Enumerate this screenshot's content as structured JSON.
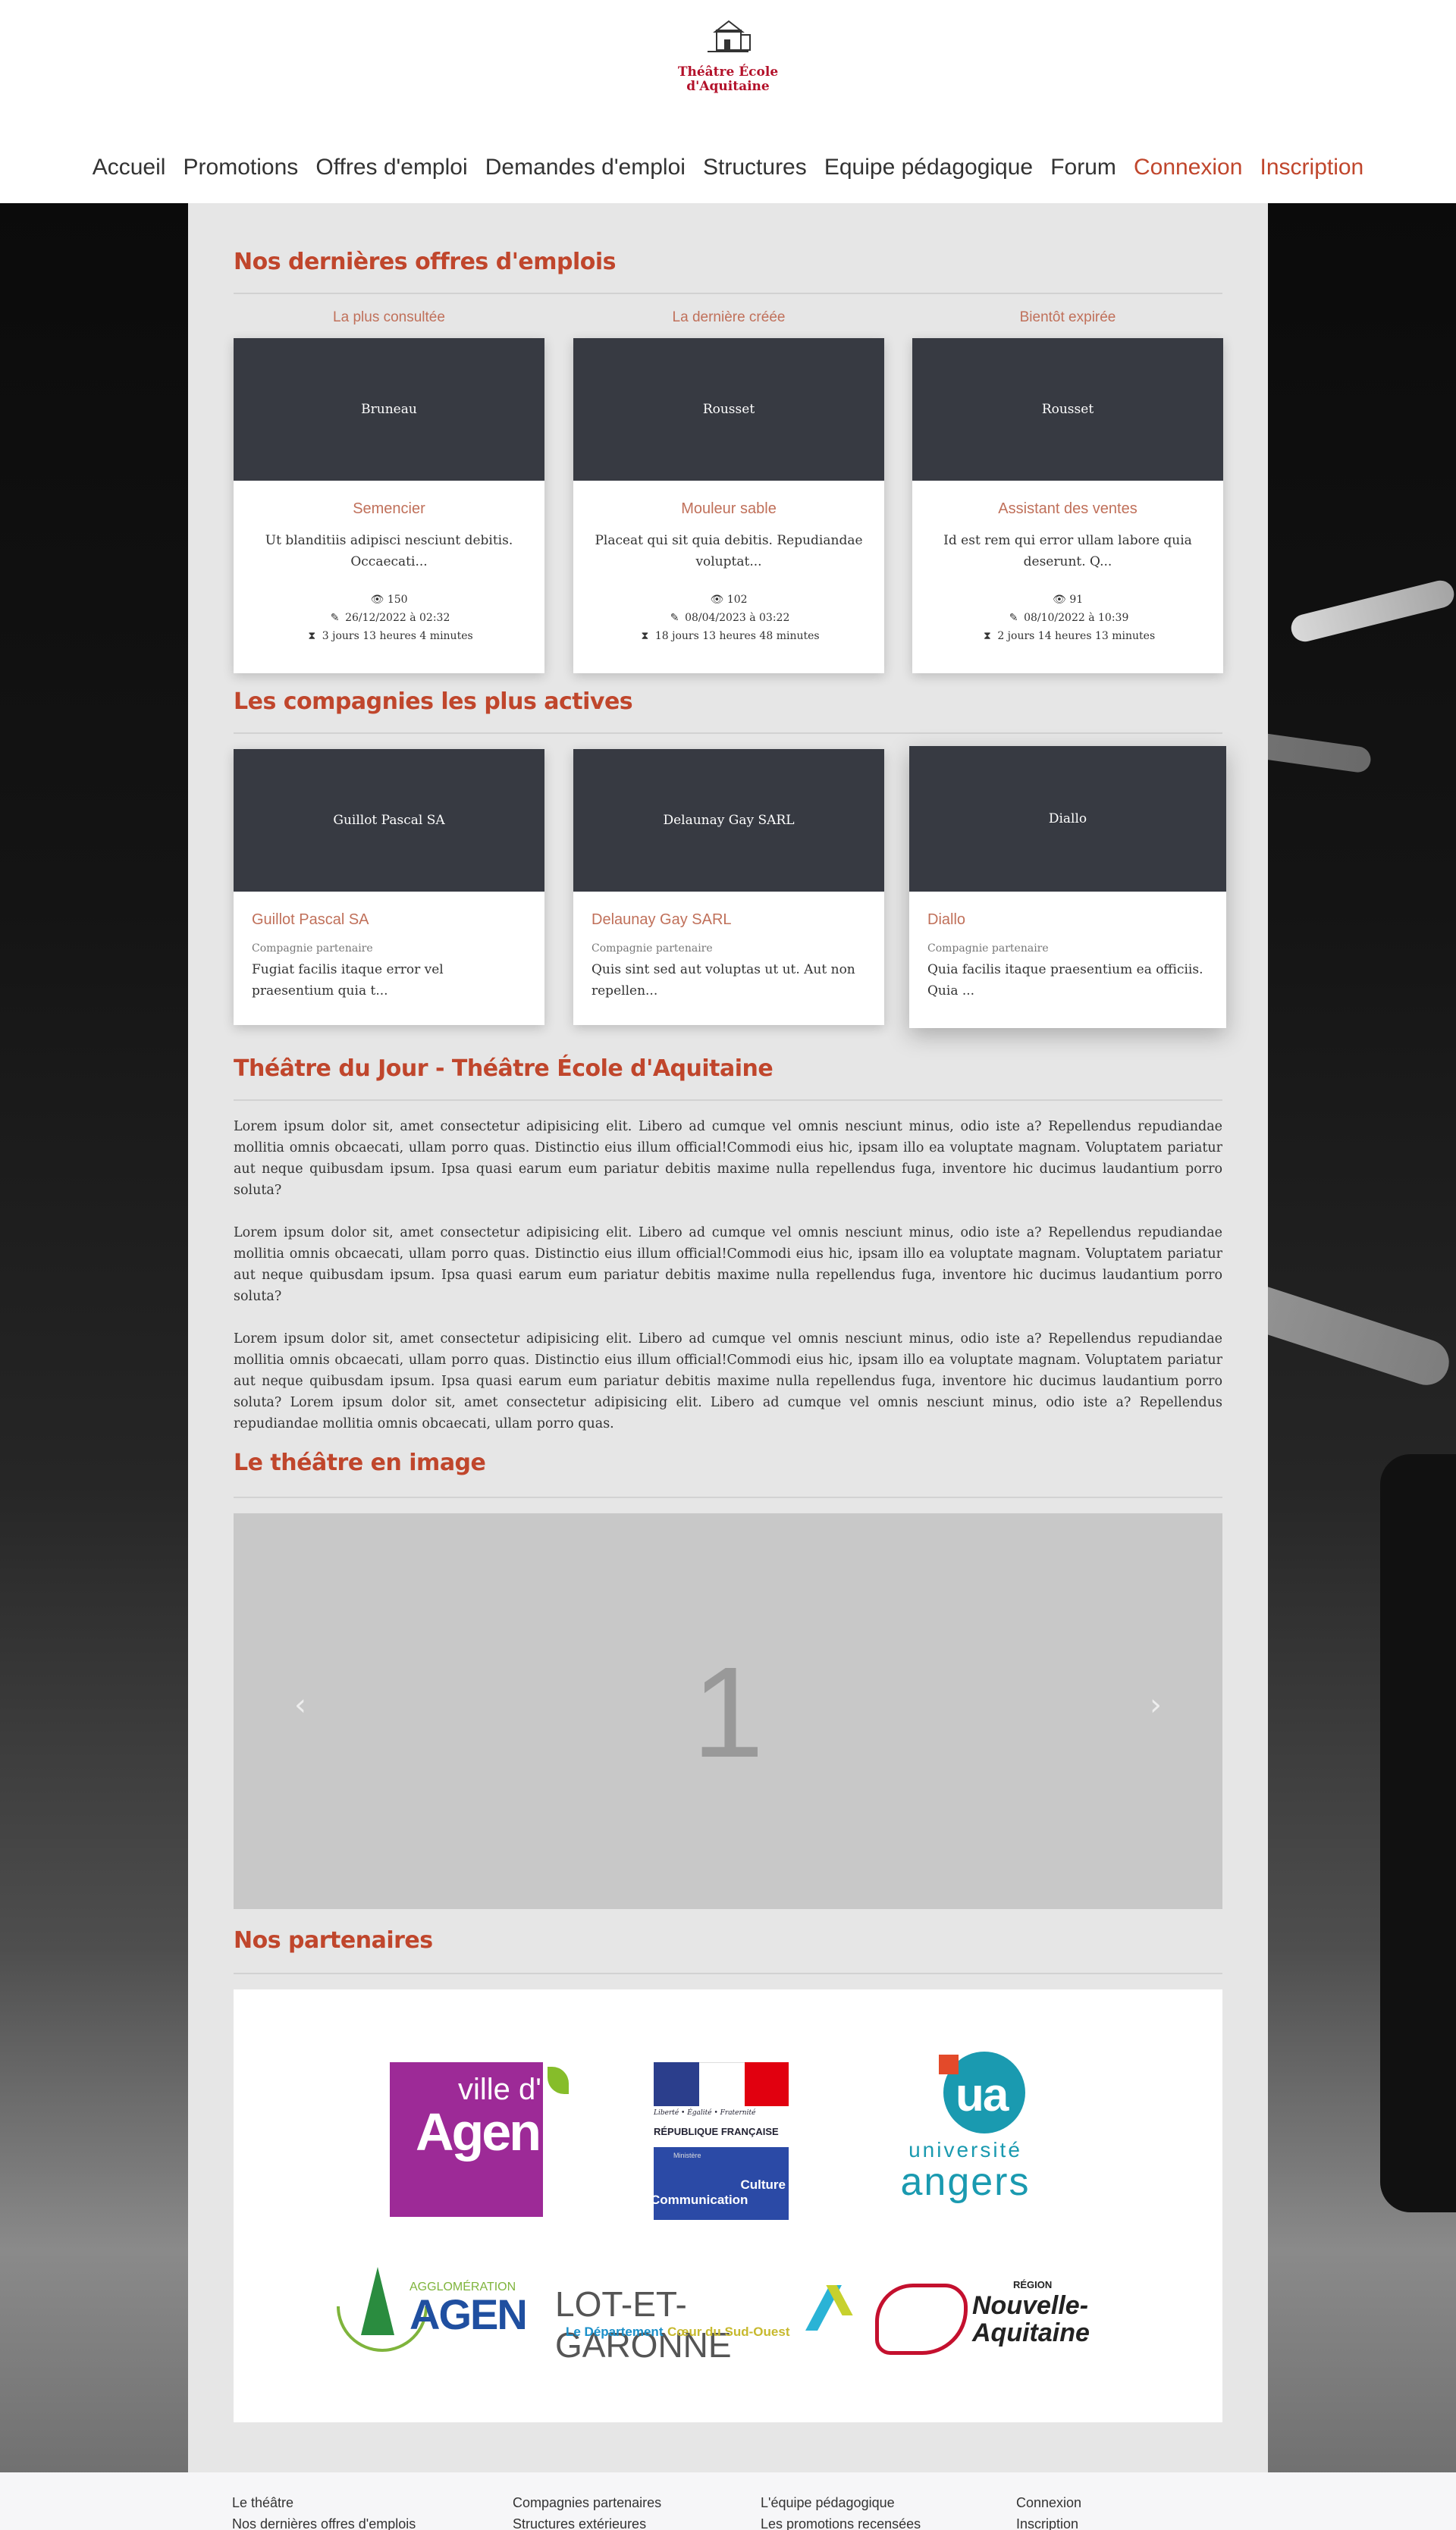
{
  "logo": {
    "line1": "Théâtre École",
    "line2": "d'Aquitaine"
  },
  "nav": [
    {
      "label": "Accueil",
      "accent": false
    },
    {
      "label": "Promotions",
      "accent": false
    },
    {
      "label": "Offres d'emploi",
      "accent": false
    },
    {
      "label": "Demandes d'emploi",
      "accent": false
    },
    {
      "label": "Structures",
      "accent": false
    },
    {
      "label": "Equipe pédagogique",
      "accent": false
    },
    {
      "label": "Forum",
      "accent": false
    },
    {
      "label": "Connexion",
      "accent": true
    },
    {
      "label": "Inscription",
      "accent": true
    }
  ],
  "offers": {
    "title": "Nos dernières offres d'emplois",
    "items": [
      {
        "label": "La plus consultée",
        "company": "Bruneau",
        "job": "Semencier",
        "desc": "Ut blanditiis adipisci nesciunt debitis. Occaecati...",
        "views": "150",
        "created": "26/12/2022 à 02:32",
        "remaining": "3 jours 13 heures 4 minutes"
      },
      {
        "label": "La dernière créée",
        "company": "Rousset",
        "job": "Mouleur sable",
        "desc": "Placeat qui sit quia debitis. Repudiandae voluptat...",
        "views": "102",
        "created": "08/04/2023 à 03:22",
        "remaining": "18 jours 13 heures 48 minutes"
      },
      {
        "label": "Bientôt expirée",
        "company": "Rousset",
        "job": "Assistant des ventes",
        "desc": "Id est rem qui error ullam labore quia deserunt. Q...",
        "views": "91",
        "created": "08/10/2022 à 10:39",
        "remaining": "2 jours 14 heures 13 minutes"
      }
    ]
  },
  "companies": {
    "title": "Les compagnies les plus actives",
    "items": [
      {
        "name": "Guillot Pascal SA",
        "type": "Compagnie partenaire",
        "desc": "Fugiat facilis itaque error vel praesentium quia t..."
      },
      {
        "name": "Delaunay Gay SARL",
        "type": "Compagnie partenaire",
        "desc": "Quis sint sed aut voluptas ut ut. Aut non repellen..."
      },
      {
        "name": "Diallo",
        "type": "Compagnie partenaire",
        "desc": "Quia facilis itaque praesentium ea officiis. Quia ..."
      }
    ]
  },
  "theatre": {
    "title": "Théâtre du Jour - Théâtre École d'Aquitaine",
    "paragraphs": [
      "Lorem ipsum dolor sit, amet consectetur adipisicing elit. Libero ad cumque vel omnis nesciunt minus, odio iste a? Repellendus repudiandae mollitia omnis obcaecati, ullam porro quas. Distinctio eius illum official!Commodi eius hic, ipsam illo ea voluptate magnam. Voluptatem pariatur aut neque quibusdam ipsum. Ipsa quasi earum eum pariatur debitis maxime nulla repellendus fuga, inventore hic ducimus laudantium porro soluta?",
      "Lorem ipsum dolor sit, amet consectetur adipisicing elit. Libero ad cumque vel omnis nesciunt minus, odio iste a? Repellendus repudiandae mollitia omnis obcaecati, ullam porro quas. Distinctio eius illum official!Commodi eius hic, ipsam illo ea voluptate magnam. Voluptatem pariatur aut neque quibusdam ipsum. Ipsa quasi earum eum pariatur debitis maxime nulla repellendus fuga, inventore hic ducimus laudantium porro soluta?",
      "Lorem ipsum dolor sit, amet consectetur adipisicing elit. Libero ad cumque vel omnis nesciunt minus, odio iste a? Repellendus repudiandae mollitia omnis obcaecati, ullam porro quas. Distinctio eius illum official!Commodi eius hic, ipsam illo ea voluptate magnam. Voluptatem pariatur aut neque quibusdam ipsum. Ipsa quasi earum eum pariatur debitis maxime nulla repellendus fuga, inventore hic ducimus laudantium porro soluta? Lorem ipsum dolor sit, amet consectetur adipisicing elit. Libero ad cumque vel omnis nesciunt minus, odio iste a? Repellendus repudiandae mollitia omnis obcaecati, ullam porro quas."
    ]
  },
  "gallery": {
    "title": "Le théâtre en image",
    "slide": "1",
    "prev": "‹",
    "next": "›"
  },
  "partners": {
    "title": "Nos partenaires",
    "agen_city": {
      "line1": "ville d'",
      "line2": "Agen"
    },
    "republique": {
      "motto": "Liberté • Égalité • Fraternité",
      "name": "RÉPUBLIQUE FRANÇAISE",
      "ministere": "Ministère",
      "culture": "Culture",
      "communication": "Communication"
    },
    "angers": {
      "mark": "ua",
      "line1": "université",
      "line2": "angers"
    },
    "agglo": {
      "line1": "AGGLOMÉRATION",
      "line2": "AGEN"
    },
    "lot": {
      "line1": "LOT-ET-GARONNE",
      "line2a": "Le Département",
      "line2b": "Cœur du Sud-Ouest"
    },
    "region": {
      "line1": "RÉGION",
      "line2": "Nouvelle-",
      "line3": "Aquitaine"
    }
  },
  "footer": {
    "col1": [
      "Le théâtre",
      "Nos dernières offres d'emplois"
    ],
    "col2": [
      "Compagnies partenaires",
      "Structures extérieures"
    ],
    "col3": [
      "L'équipe pédagogique",
      "Les promotions recensées"
    ],
    "col4": [
      "Connexion",
      "Inscription"
    ]
  },
  "colors": {
    "accent": "#c0462c",
    "card_head": "#373a42",
    "logo_red": "#b3112a"
  }
}
